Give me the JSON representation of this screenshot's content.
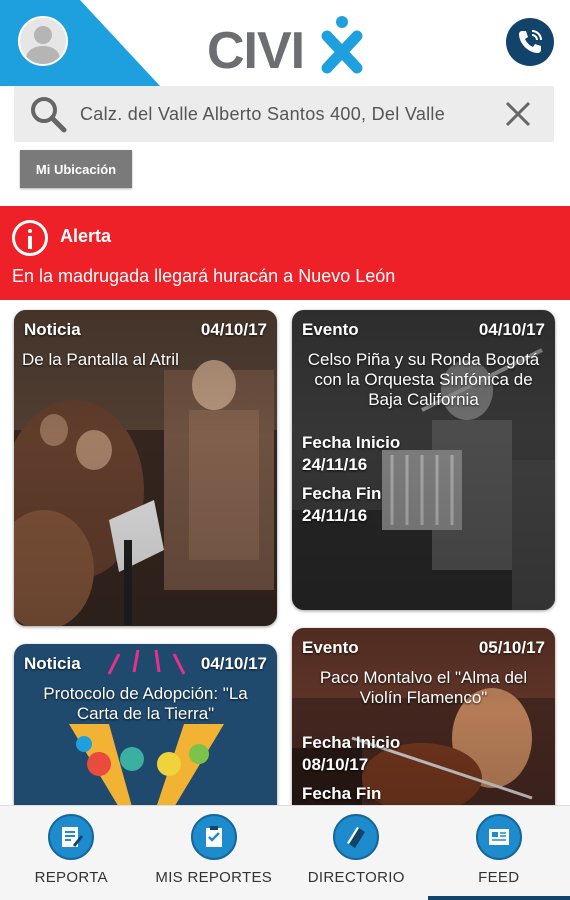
{
  "app": {
    "logo_text": "CIVIX",
    "colors": {
      "brand_blue": "#12446b",
      "accent_cyan": "#1ea0df",
      "alert_red": "#ee2128"
    }
  },
  "header": {
    "avatar_icon": "user-avatar-icon",
    "phone_icon": "phone-icon"
  },
  "search": {
    "value": "Calz. del Valle Alberto Santos 400, Del Valle",
    "icon": "search-icon",
    "clear_icon": "close-icon"
  },
  "location_button": {
    "label": "Mi Ubicación"
  },
  "alert": {
    "icon": "info-alert-icon",
    "title": "Alerta",
    "message": "En la madrugada llegará huracán a Nuevo León"
  },
  "cards": [
    {
      "type": "Noticia",
      "date": "04/10/17",
      "title": "De la Pantalla al Atril"
    },
    {
      "type": "Evento",
      "date": "04/10/17",
      "title": "Celso Piña y su Ronda Bogotá con la Orquesta Sinfónica de Baja California",
      "start_label": "Fecha Inicio",
      "start_date": "24/11/16",
      "end_label": "Fecha Fin",
      "end_date": "24/11/16"
    },
    {
      "type": "Noticia",
      "date": "04/10/17",
      "title": "Protocolo de Adopción: \"La Carta de la Tierra\""
    },
    {
      "type": "Evento",
      "date": "05/10/17",
      "title": "Paco Montalvo el \"Alma del Violín Flamenco\"",
      "start_label": "Fecha Inicio",
      "start_date": "08/10/17",
      "end_label": "Fecha Fin"
    }
  ],
  "bottom_nav": [
    {
      "label": "REPORTA",
      "icon": "report-form-icon"
    },
    {
      "label": "MIS REPORTES",
      "icon": "clipboard-check-icon"
    },
    {
      "label": "DIRECTORIO",
      "icon": "book-icon"
    },
    {
      "label": "FEED",
      "icon": "newspaper-icon",
      "active": true
    }
  ]
}
